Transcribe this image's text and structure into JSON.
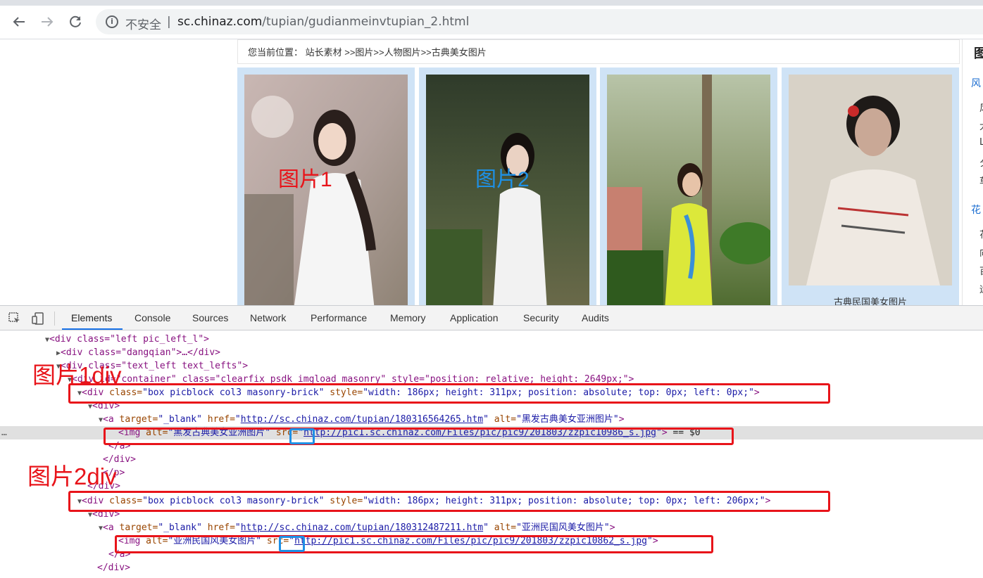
{
  "browser": {
    "back_icon": "arrow-left-icon",
    "forward_icon": "arrow-right-icon",
    "reload_icon": "reload-icon",
    "info_icon": "info-icon",
    "security_label": "不安全",
    "separator": "|",
    "url_host": "sc.chinaz.com",
    "url_path": "/tupian/gudianmeinvtupian_2.html"
  },
  "page": {
    "breadcrumb": "您当前位置：  站长素材 >>图片>>人物图片>>古典美女图片",
    "cards": [
      {
        "overlay": "图片1",
        "overlay_color": "#e8141a",
        "caption": ""
      },
      {
        "overlay": "图片2",
        "overlay_color": "#1e90e6",
        "caption": ""
      },
      {
        "overlay": "",
        "overlay_color": "",
        "caption": ""
      },
      {
        "overlay": "",
        "overlay_color": "",
        "caption": "古典民国美女图片"
      }
    ],
    "sidebar": {
      "heading": "图",
      "cat1": "风",
      "cat1_items": [
        "风",
        "大",
        "L",
        "夕",
        "草"
      ],
      "cat2": "花",
      "cat2_items": [
        "花",
        "向",
        "百",
        "运"
      ]
    }
  },
  "devtools": {
    "inspect_icon": "inspect-element-icon",
    "device_icon": "device-toolbar-icon",
    "tabs": [
      "Elements",
      "Console",
      "Sources",
      "Network",
      "Performance",
      "Memory",
      "Application",
      "Security",
      "Audits"
    ],
    "active_tab": "Elements",
    "dom": {
      "l0_tag": "<div class=\"left pic_left_l\">",
      "l1_tag": "<div class=\"dangqian\">…</div>",
      "l2_tag": "<div class=\"text_left text_lefts\">",
      "l3_tag": "<div id=\"container\" class=\"clearfix psdk imgload masonry\" style=\"position: relative; height: 2649px;\">",
      "box1": {
        "open": "<div",
        "class_attr": " class=",
        "class_val": "\"box picblock col3 masonry-brick\"",
        "style_attr": " style=",
        "style_val": "\"width: 186px; height: 311px; position: absolute; top: 0px; left: 0px;\"",
        "close": ">"
      },
      "div_open": "<div>",
      "a1": {
        "open": "<a",
        "target_attr": " target=",
        "target_val": "\"_blank\"",
        "href_attr": " href=",
        "href_val": "http://sc.chinaz.com/tupian/180316564265.htm",
        "alt_attr": " alt=",
        "alt_val": "\"黑发古典美女亚洲图片\"",
        "close": ">"
      },
      "img1": {
        "open": "<img",
        "alt_attr": " alt=",
        "alt_val": "\"黑发古典美女亚洲图片\"",
        "src_attr": " src",
        "src_eq": "=",
        "src_val": "http://pic1.sc.chinaz.com/Files/pic/pic9/201803/zzpic10986_s.jpg",
        "close": ">",
        "console_ref": " == $0"
      },
      "a_close": "</a>",
      "div_close": "</div>",
      "p_close": "</p>",
      "box2": {
        "open": "<div",
        "class_attr": " class=",
        "class_val": "\"box picblock col3 masonry-brick\"",
        "style_attr": " style=",
        "style_val": "\"width: 186px; height: 311px; position: absolute; top: 0px; left: 206px;\"",
        "close": ">"
      },
      "a2": {
        "open": "<a",
        "target_attr": " target=",
        "target_val": "\"_blank\"",
        "href_attr": " href=",
        "href_val": "http://sc.chinaz.com/tupian/180312487211.htm",
        "alt_attr": " alt=",
        "alt_val": "\"亚洲民国风美女图片\"",
        "close": ">"
      },
      "img2": {
        "open": "<img",
        "alt_attr": " alt=",
        "alt_val": "\"亚洲民国风美女图片\"",
        "src_attr": " src",
        "src_eq": "=",
        "src_val": "http://pic1.sc.chinaz.com/Files/pic/pic9/201803/zzpic10862_s.jpg",
        "close": ">"
      },
      "ellipsis": "…"
    },
    "annotations": {
      "label1": "图片1div",
      "label2": "图片2div",
      "box_color": "#e8141a",
      "src_box_color": "#1e90e6"
    }
  }
}
